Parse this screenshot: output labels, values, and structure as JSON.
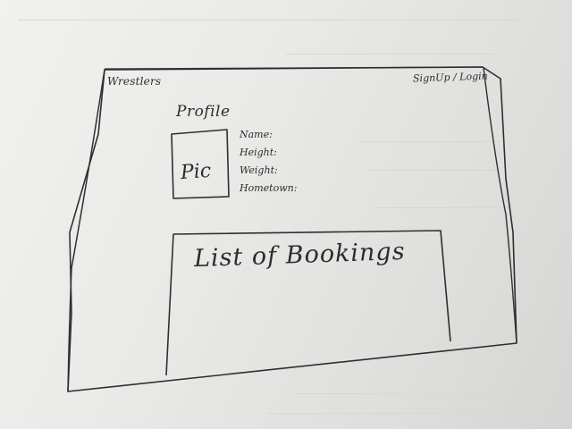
{
  "header": {
    "brand": "Wrestlers",
    "auth": "SignUp / Login"
  },
  "profile": {
    "title": "Profile",
    "pic_label": "Pic",
    "fields": [
      {
        "label": "Name:"
      },
      {
        "label": "Height:"
      },
      {
        "label": "Weight:"
      },
      {
        "label": "Hometown:"
      }
    ]
  },
  "bookings": {
    "title": "List of Bookings"
  },
  "colors": {
    "ink": "#2b2b2b",
    "paper": "#ececea"
  }
}
